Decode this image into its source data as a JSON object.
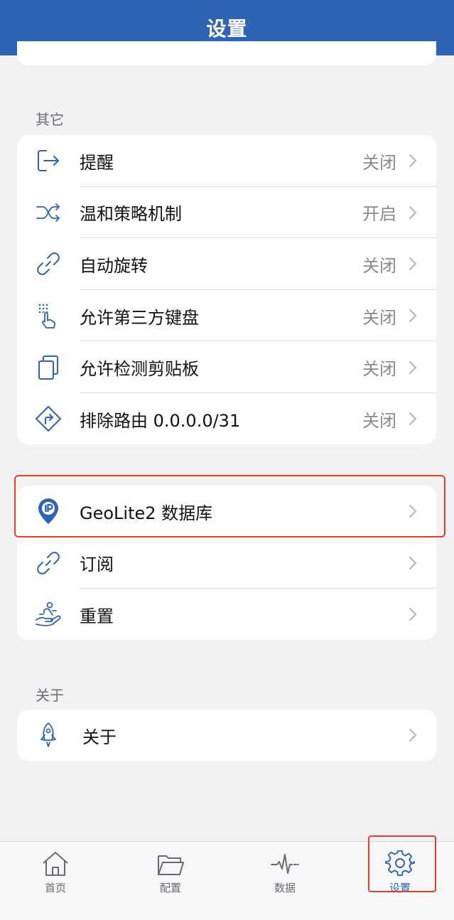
{
  "header": {
    "title": "设置"
  },
  "sections": {
    "other_label": "其它",
    "about_label": "关于"
  },
  "other_items": [
    {
      "label": "提醒",
      "value": "关闭",
      "icon": "exit-arrow-icon"
    },
    {
      "label": "温和策略机制",
      "value": "开启",
      "icon": "shuffle-icon"
    },
    {
      "label": "自动旋转",
      "value": "关闭",
      "icon": "link-icon"
    },
    {
      "label": "允许第三方键盘",
      "value": "关闭",
      "icon": "keyboard-touch-icon"
    },
    {
      "label": "允许检测剪贴板",
      "value": "关闭",
      "icon": "copy-icon"
    },
    {
      "label": "排除路由 0.0.0.0/31",
      "value": "关闭",
      "icon": "route-sign-icon"
    }
  ],
  "misc_items": [
    {
      "label": "GeoLite2 数据库",
      "icon": "ip-pin-icon"
    },
    {
      "label": "订阅",
      "icon": "link-icon"
    },
    {
      "label": "重置",
      "icon": "hand-reset-icon"
    }
  ],
  "about_items": [
    {
      "label": "关于",
      "icon": "rocket-icon"
    }
  ],
  "tabs": [
    {
      "label": "首页",
      "icon": "home-icon",
      "active": false
    },
    {
      "label": "配置",
      "icon": "folder-icon",
      "active": false
    },
    {
      "label": "数据",
      "icon": "pulse-icon",
      "active": false
    },
    {
      "label": "设置",
      "icon": "gear-icon",
      "active": true
    }
  ],
  "colors": {
    "accent": "#2e64b3",
    "highlight": "#e2402a",
    "background": "#f2f2f4"
  }
}
